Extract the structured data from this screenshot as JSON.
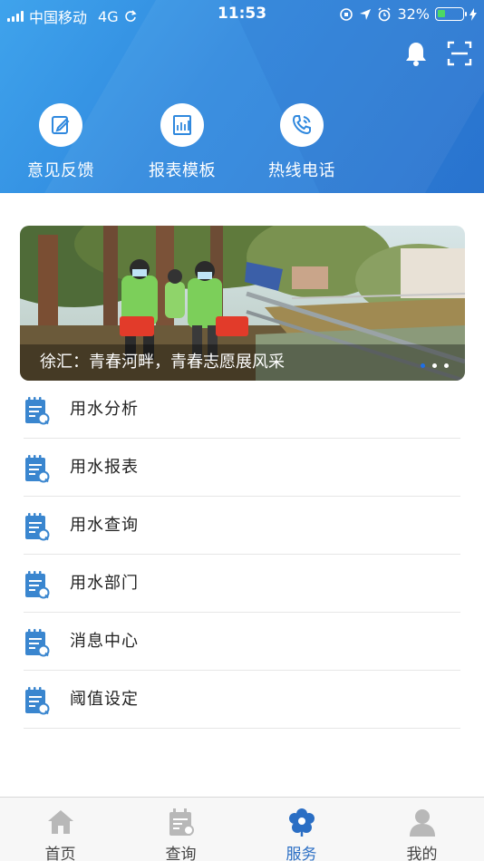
{
  "status_bar": {
    "carrier": "中国移动",
    "network": "4G",
    "time": "11:53",
    "battery": "32%",
    "battery_level": 0.32
  },
  "header": {
    "actions": [
      {
        "icon": "bell-icon"
      },
      {
        "icon": "scan-icon"
      }
    ],
    "quick_actions": [
      {
        "label": "意见反馈",
        "icon": "feedback-edit-icon"
      },
      {
        "label": "报表模板",
        "icon": "report-chart-icon"
      },
      {
        "label": "热线电话",
        "icon": "phone-icon"
      }
    ]
  },
  "banner": {
    "caption": "徐汇：青春河畔，青春志愿展风采",
    "slides": 3,
    "active_slide": 1
  },
  "menu": {
    "items": [
      {
        "label": "用水分析",
        "icon": "notepad-search-icon"
      },
      {
        "label": "用水报表",
        "icon": "notepad-search-icon"
      },
      {
        "label": "用水查询",
        "icon": "notepad-search-icon"
      },
      {
        "label": "用水部门",
        "icon": "notepad-search-icon"
      },
      {
        "label": "消息中心",
        "icon": "notepad-search-icon"
      },
      {
        "label": "阈值设定",
        "icon": "notepad-search-icon"
      }
    ]
  },
  "tab_bar": {
    "tabs": [
      {
        "label": "首页",
        "icon": "home-icon",
        "active": false
      },
      {
        "label": "查询",
        "icon": "calendar-search-icon",
        "active": false
      },
      {
        "label": "服务",
        "icon": "flower-icon",
        "active": true
      },
      {
        "label": "我的",
        "icon": "person-icon",
        "active": false
      }
    ]
  },
  "colors": {
    "header_blue": "#2f88de",
    "active_tab": "#2a6ec4",
    "list_icon_blue": "#3a86cf",
    "inactive_icon": "#b8b8b8"
  }
}
